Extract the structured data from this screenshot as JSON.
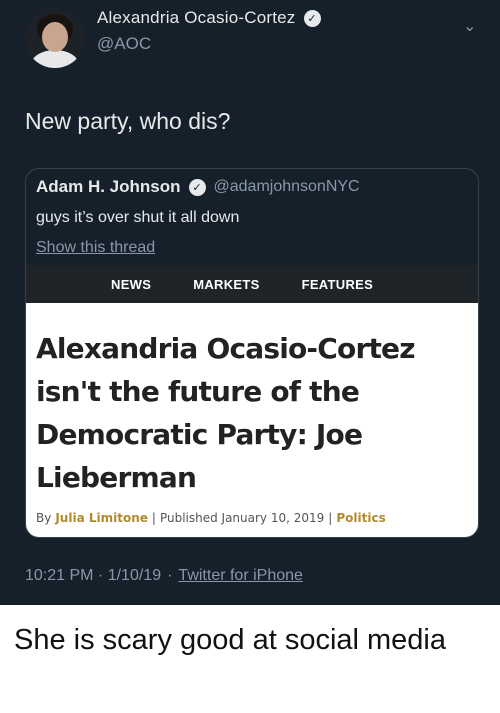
{
  "tweet": {
    "display_name": "Alexandria Ocasio-Cortez",
    "handle": "@AOC",
    "text": "New party, who dis?",
    "timestamp": "10:21 PM · 1/10/19",
    "separator": "·",
    "source": "Twitter for iPhone",
    "icons": {
      "verified": "verified-badge-icon",
      "menu": "chevron-down-icon"
    }
  },
  "quote": {
    "display_name": "Adam H. Johnson",
    "handle": "@adamjohnsonNYC",
    "text": "guys it’s over shut it all down",
    "thread_link": "Show this thread",
    "card": {
      "nav": [
        "NEWS",
        "MARKETS",
        "FEATURES"
      ],
      "headline": "Alexandria Ocasio-Cortez isn't the future of the Democratic Party: Joe Lieberman",
      "byline_prefix": "By",
      "author": "Julia Limitone",
      "published": "Published January 10, 2019",
      "section": "Politics"
    }
  },
  "caption": "She is scary good at social media",
  "colors": {
    "background": "#15202b",
    "text": "#e7e9ea",
    "muted": "#8899a6",
    "border": "#38444d",
    "accent": "#b08a2e"
  }
}
